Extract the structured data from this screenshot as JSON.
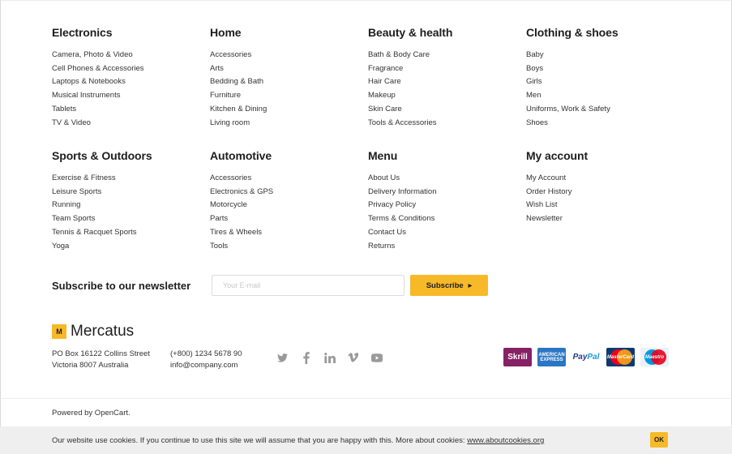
{
  "columns": [
    {
      "title": "Electronics",
      "items": [
        "Camera, Photo & Video",
        "Cell Phones & Accessories",
        "Laptops & Notebooks",
        "Musical Instruments",
        "Tablets",
        "TV & Video"
      ]
    },
    {
      "title": "Home",
      "items": [
        "Accessories",
        "Arts",
        "Bedding & Bath",
        "Furniture",
        "Kitchen & Dining",
        "Living room"
      ]
    },
    {
      "title": "Beauty & health",
      "items": [
        "Bath & Body Care",
        "Fragrance",
        "Hair Care",
        "Makeup",
        "Skin Care",
        "Tools & Accessories"
      ]
    },
    {
      "title": "Clothing & shoes",
      "items": [
        "Baby",
        "Boys",
        "Girls",
        "Men",
        "Uniforms, Work & Safety",
        "Shoes"
      ]
    },
    {
      "title": "Sports & Outdoors",
      "items": [
        "Exercise & Fitness",
        "Leisure Sports",
        "Running",
        "Team Sports",
        "Tennis & Racquet Sports",
        "Yoga"
      ]
    },
    {
      "title": "Automotive",
      "items": [
        "Accessories",
        "Electronics & GPS",
        "Motorcycle",
        "Parts",
        "Tires & Wheels",
        "Tools"
      ]
    },
    {
      "title": "Menu",
      "items": [
        "About Us",
        "Delivery Information",
        "Privacy Policy",
        "Terms & Conditions",
        "Contact Us",
        "Returns"
      ]
    },
    {
      "title": "My account",
      "items": [
        "My Account",
        "Order History",
        "Wish List",
        "Newsletter"
      ]
    }
  ],
  "newsletter": {
    "label": "Subscribe to our newsletter",
    "placeholder": "Your E-mail",
    "button": "Subscribe"
  },
  "brand": {
    "mark": "M",
    "name": "Mercatus"
  },
  "address": {
    "line1": "PO Box 16122 Collins Street",
    "line2": "Victoria 8007 Australia"
  },
  "contact": {
    "phone": "(+800) 1234 5678 90",
    "email": "info@company.com"
  },
  "social": [
    "twitter-icon",
    "facebook-icon",
    "linkedin-icon",
    "vimeo-icon",
    "youtube-icon"
  ],
  "payments": {
    "skrill": "Skrill",
    "amex_line1": "AMERICAN",
    "amex_line2": "EXPRESS",
    "paypal_a": "Pay",
    "paypal_b": "Pal",
    "mastercard": "MasterCard",
    "maestro": "Maestro"
  },
  "powered": "Powered by OpenCart.",
  "cookie": {
    "message": "Our website use cookies. If you continue to use this site we will assume that you are happy with this. More about cookies:",
    "link": "www.aboutcookies.org",
    "ok": "OK"
  },
  "colors": {
    "accent": "#f7b928",
    "text": "#1e1e1e",
    "cookie_bg": "#efefef"
  }
}
